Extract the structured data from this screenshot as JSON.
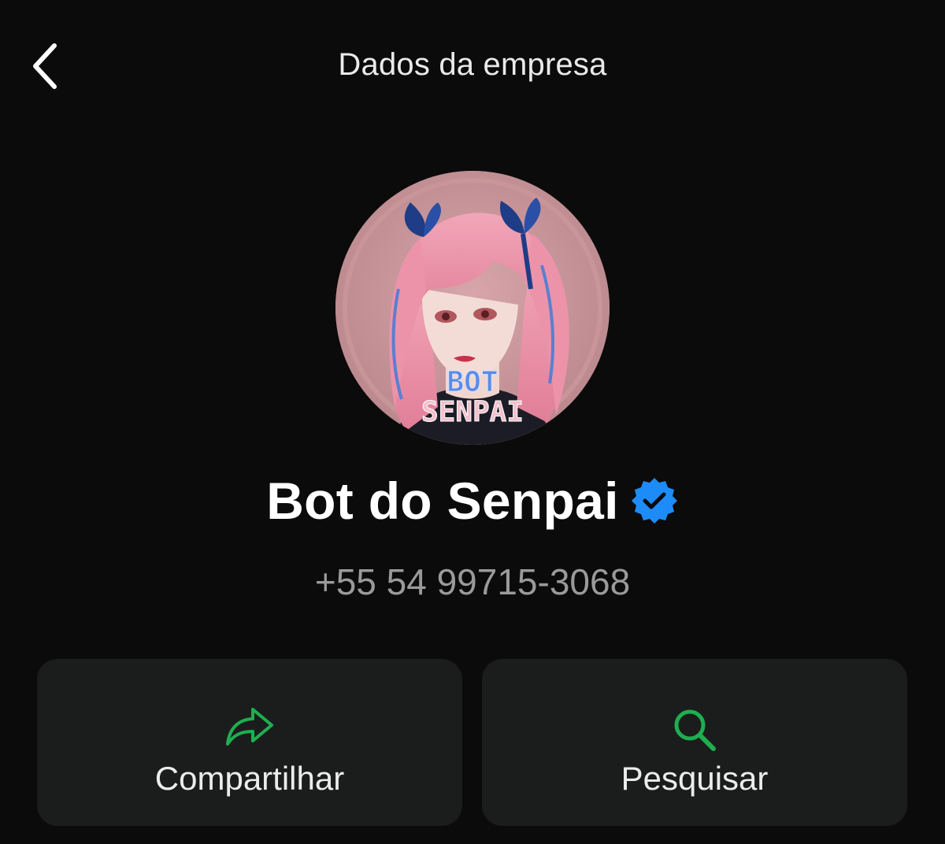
{
  "header": {
    "title": "Dados da empresa",
    "back_icon": "chevron-left-icon"
  },
  "profile": {
    "avatar_text_line1": "BOT",
    "avatar_text_line2": "SENPAI",
    "name": "Bot do Senpai",
    "verified_icon": "verified-badge-icon",
    "phone": "+55 54 99715-3068"
  },
  "actions": [
    {
      "label": "Compartilhar",
      "icon": "share-icon"
    },
    {
      "label": "Pesquisar",
      "icon": "search-icon"
    }
  ],
  "colors": {
    "background": "#0b0b0b",
    "card": "#1b1d1d",
    "accent_green": "#1fae50",
    "verified_blue": "#1d8cf8",
    "phone_text": "#9a9a9a"
  }
}
